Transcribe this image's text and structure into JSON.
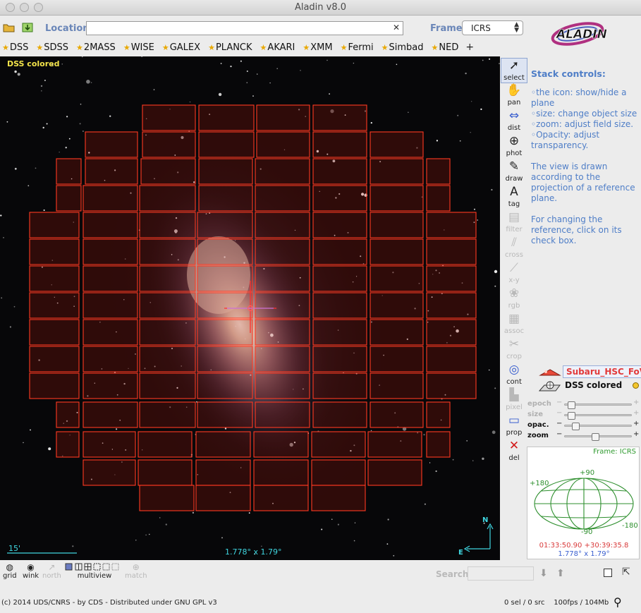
{
  "window": {
    "title": "Aladin v8.0"
  },
  "toolbar": {
    "location_label": "Location",
    "location_value": "",
    "frame_label": "Frame",
    "frame_value": "ICRS"
  },
  "surveys": [
    "DSS",
    "SDSS",
    "2MASS",
    "WISE",
    "GALEX",
    "PLANCK",
    "AKARI",
    "XMM",
    "Fermi",
    "Simbad",
    "NED"
  ],
  "survey_add": "+",
  "view": {
    "label": "DSS colored",
    "scale": "15'",
    "fov": "1.778° x 1.79°",
    "compass_n": "N",
    "compass_e": "E"
  },
  "tools": [
    {
      "label": "select",
      "icon": "cursor-arrow-icon",
      "enabled": true
    },
    {
      "label": "pan",
      "icon": "hand-icon",
      "enabled": true
    },
    {
      "label": "dist",
      "icon": "ruler-arrow-icon",
      "enabled": true
    },
    {
      "label": "phot",
      "icon": "crosshair-circle-icon",
      "enabled": true
    },
    {
      "label": "draw",
      "icon": "pencil-icon",
      "enabled": true
    },
    {
      "label": "tag",
      "icon": "text-tag-icon",
      "enabled": true
    },
    {
      "label": "filter",
      "icon": "filter-icon",
      "enabled": false
    },
    {
      "label": "cross",
      "icon": "cross-icon",
      "enabled": false
    },
    {
      "label": "x-y",
      "icon": "xy-plot-icon",
      "enabled": false
    },
    {
      "label": "rgb",
      "icon": "rgb-circles-icon",
      "enabled": false
    },
    {
      "label": "assoc",
      "icon": "film-assoc-icon",
      "enabled": false
    },
    {
      "label": "crop",
      "icon": "scissors-icon",
      "enabled": false
    },
    {
      "label": "cont",
      "icon": "contour-icon",
      "enabled": true
    },
    {
      "label": "pixel",
      "icon": "pixel-icon",
      "enabled": false
    },
    {
      "label": "prop",
      "icon": "properties-icon",
      "enabled": true
    },
    {
      "label": "del",
      "icon": "delete-x-icon",
      "enabled": true
    }
  ],
  "help": {
    "title": "Stack controls:",
    "items": [
      "◦the icon: show/hide a plane",
      "◦size: change object size",
      "◦zoom: adjust field size.",
      "◦Opacity: adjust transparency."
    ],
    "para1": "The view is drawn according to the projection of a reference plane.",
    "para2": "For changing the reference, click on its check box."
  },
  "planes": [
    {
      "name": "Subaru_HSC_FoV",
      "color": "#e23a3a"
    },
    {
      "name": "DSS colored",
      "color": "#111111"
    }
  ],
  "sliders": [
    {
      "label": "epoch",
      "enabled": false,
      "level": 0.05
    },
    {
      "label": "size",
      "enabled": false,
      "level": 0.05
    },
    {
      "label": "opac.",
      "enabled": true,
      "level": 0.12
    },
    {
      "label": "zoom",
      "enabled": true,
      "level": 0.45
    }
  ],
  "minimap": {
    "frame": "Frame: ICRS",
    "top": "+90",
    "bottom": "-90",
    "left": "+180",
    "right": "-180",
    "coords": "01:33:50.90 +30:39:35.8",
    "fov": "1.778° x 1.79°"
  },
  "bottom_tools": [
    {
      "label": "grid",
      "icon": "grid-globe-icon",
      "enabled": true
    },
    {
      "label": "wink",
      "icon": "eye-icon",
      "enabled": true
    },
    {
      "label": "north",
      "icon": "north-arrow-icon",
      "enabled": false
    },
    {
      "label": "multiview",
      "icon": "multiview-icon",
      "enabled": true
    },
    {
      "label": "match",
      "icon": "match-icon",
      "enabled": false
    }
  ],
  "search_label": "Search",
  "status": {
    "left": "(c) 2014 UDS/CNRS - by CDS - Distributed under GNU GPL v3",
    "right": "0 sel / 0 src    100fps / 104Mb"
  },
  "colors": {
    "accent": "#6a86b8",
    "overlay": "#ff2a1a",
    "scale": "#3fd6e0",
    "view_label": "#f2e34a"
  }
}
